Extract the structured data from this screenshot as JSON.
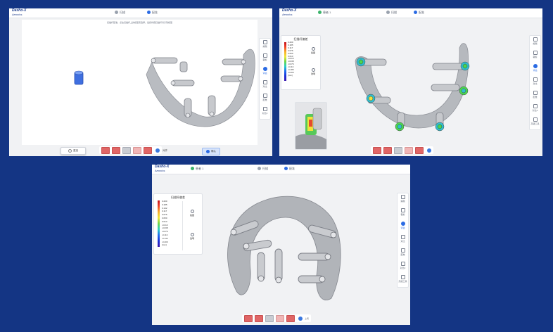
{
  "brand": {
    "name": "Dasho-X",
    "sub": "Aeonios"
  },
  "sidebar": [
    {
      "label": "编辑"
    },
    {
      "label": "裁剪"
    },
    {
      "label": "评估"
    },
    {
      "label": "对比"
    },
    {
      "label": "配准"
    },
    {
      "label": "对比2"
    },
    {
      "label": "测量"
    },
    {
      "label": "高级工具"
    }
  ],
  "screen1": {
    "tab_left": "",
    "tab_center": "扫描",
    "tab_right": "配准",
    "instruction": "扫描杆配准，点击扫描杆上的模型来选择，最终将把扫描杆对齐到模型",
    "options": [
      "重选",
      "选择",
      "对齐",
      "确认"
    ],
    "active_option_index": 3
  },
  "screen2": {
    "tab_left": "患者 1",
    "tab_center": "扫描",
    "tab_right": "配准"
  },
  "screen3": {
    "tab_left": "患者 1",
    "tab_center": "扫描",
    "tab_right": "配准"
  },
  "deviation_panel": {
    "title": "扫描杆偏差",
    "values": [
      "0.200",
      "0.185",
      "0.142",
      "0.117",
      "0.076",
      "0.050",
      "0.013",
      "-0.013",
      "-0.038",
      "-0.076",
      "-0.113",
      "-0.142",
      "-0.185",
      "-0.200"
    ],
    "unit": "[mm]",
    "btn_a": "截图",
    "btn_b": "透明"
  },
  "bottombar": {
    "upload_label": "上传"
  },
  "colors": {
    "accent": "#2b6be4",
    "background": "#143584",
    "legend_high": "#c3121a",
    "legend_low": "#3d1ab0"
  },
  "icons": [
    "scan-icon",
    "cloud-upload-icon",
    "screenshot-icon",
    "transparency-icon",
    "edit-icon"
  ]
}
